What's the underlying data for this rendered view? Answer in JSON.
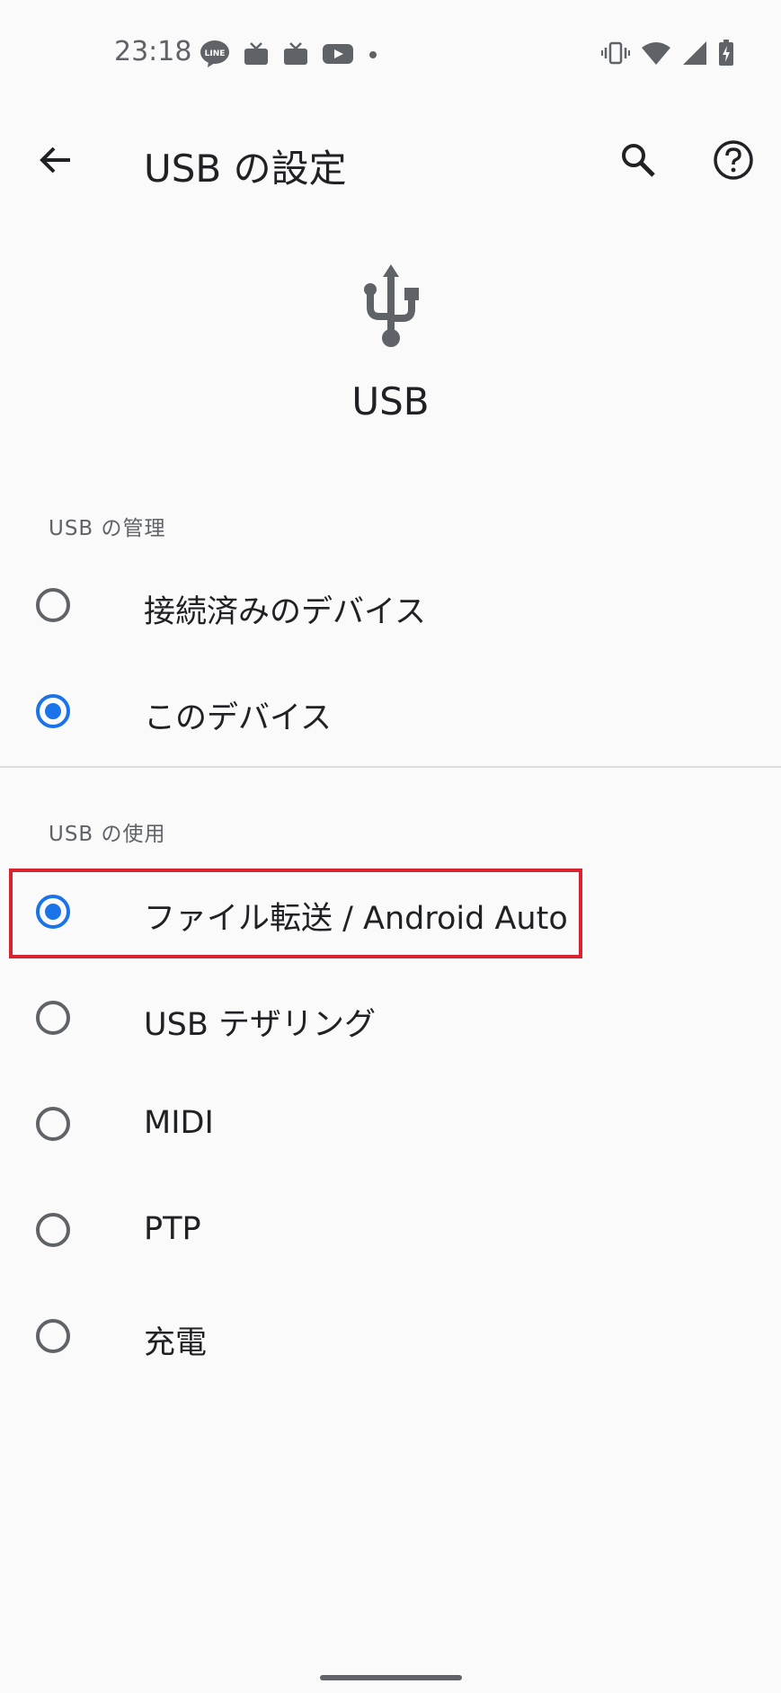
{
  "status_bar": {
    "time": "23:18",
    "notification_icons": [
      "line-icon",
      "tv-icon",
      "tv-icon",
      "youtube-icon",
      "dot-icon"
    ],
    "system_icons": [
      "vibrate-icon",
      "wifi-icon",
      "signal-icon",
      "battery-charging-icon"
    ],
    "line_badge": "LINE"
  },
  "appbar": {
    "title": "USB の設定"
  },
  "header": {
    "label": "USB"
  },
  "sections": {
    "usb_management": {
      "title": "USB の管理",
      "options": [
        {
          "label": "接続済みのデバイス",
          "checked": false
        },
        {
          "label": "このデバイス",
          "checked": true
        }
      ]
    },
    "usb_usage": {
      "title": "USB の使用",
      "options": [
        {
          "label": "ファイル転送 / Android Auto",
          "checked": true
        },
        {
          "label": "USB テザリング",
          "checked": false
        },
        {
          "label": "MIDI",
          "checked": false
        },
        {
          "label": "PTP",
          "checked": false
        },
        {
          "label": "充電",
          "checked": false
        }
      ]
    }
  },
  "colors": {
    "accent": "#1a73e8",
    "highlight": "#d9232e",
    "secondary_text": "#5f6368"
  }
}
